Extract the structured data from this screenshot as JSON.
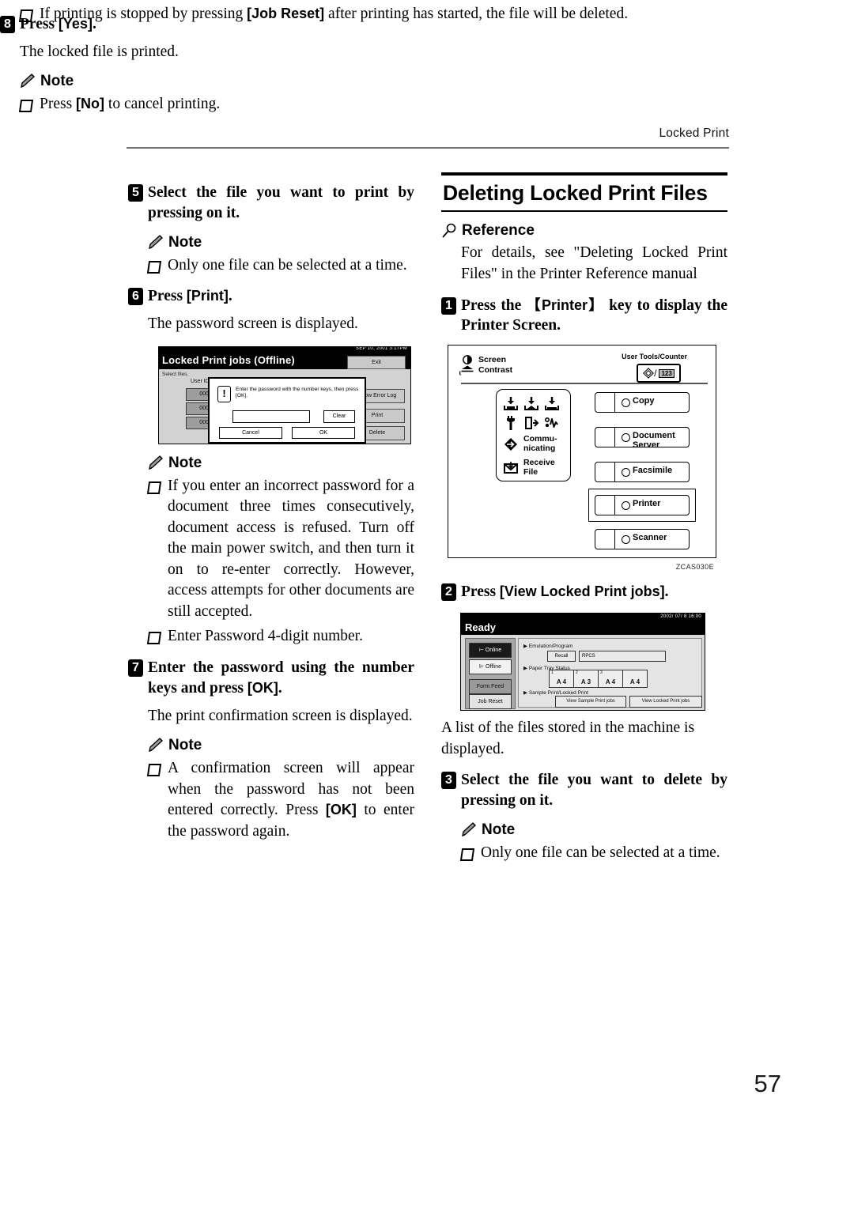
{
  "header": {
    "running_head": "Locked Print"
  },
  "page_number": "57",
  "left_column": {
    "step5": {
      "num": "5",
      "text": "Select the file you want to print by pressing on it."
    },
    "note1": {
      "label": "Note",
      "items": [
        "Only one file can be selected at a time."
      ]
    },
    "step6": {
      "num": "6",
      "text_before": "Press ",
      "key": "[Print]",
      "text_after": ".",
      "body": "The password screen is displayed."
    },
    "figure1": {
      "name": "locked-print-jobs-offline-screen",
      "date": "SEP  10, 2001  3:17PM",
      "title": "Locked Print jobs (Offline)",
      "exit_button": "Exit",
      "select_files_label": "Select files.",
      "user_id_label": "User ID",
      "file_items": [
        "0001",
        "0001",
        "0001"
      ],
      "right_buttons": [
        "Show Error Log",
        "Print",
        "Delete"
      ],
      "dialog": {
        "icon": "!",
        "message": "Enter the password with the number keys, then press [OK].",
        "input_value": "",
        "clear_button": "Clear",
        "cancel_button": "Cancel",
        "ok_button": "OK"
      }
    },
    "note2": {
      "label": "Note",
      "items": [
        "If you enter an incorrect password for a document three times consecutively, document access is refused. Turn off the main power switch, and then turn it on to re-enter correctly. However, access attempts for other documents are still accepted.",
        "Enter Password 4-digit number."
      ]
    },
    "step7": {
      "num": "7",
      "text_before": "Enter the password using the number keys and press ",
      "key": "[OK]",
      "text_after": ".",
      "body": "The print confirmation screen is displayed."
    },
    "note3": {
      "label": "Note",
      "item_part1": "A confirmation screen will appear when the password has not been entered correctly. Press ",
      "item_key": "[OK]",
      "item_part2": " to enter the password again."
    },
    "step8": {
      "num": "8",
      "text_before": "Press ",
      "key": "[Yes]",
      "text_after": ".",
      "body": "The locked file is printed."
    },
    "note4": {
      "label": "Note",
      "item1_part1": "Press ",
      "item1_key": "[No]",
      "item1_part2": " to cancel printing.",
      "item2_part1": "If printing is stopped by pressing ",
      "item2_key": "[Job Reset]",
      "item2_part2": " after printing has started, the file will be deleted."
    }
  },
  "right_column": {
    "section_title": "Deleting Locked Print Files",
    "reference": {
      "label": "Reference",
      "body": "For details, see \"Deleting Locked Print Files\" in the Printer Reference manual"
    },
    "step1": {
      "num": "1",
      "text_before": "Press the ",
      "key": "【Printer】",
      "text_after": " key to display the Printer Screen."
    },
    "figure2": {
      "name": "operation-panel-diagram",
      "screen_contrast_label": "Screen\nContrast",
      "screen_contrast_line1": "Screen",
      "screen_contrast_line2": "Contrast",
      "user_tools_label": "User Tools/Counter",
      "user_tools_123": "123",
      "status_icons": [
        {
          "icon": "load-paper-icon",
          "label": ""
        },
        {
          "icon": "add-toner-icon",
          "label": ""
        },
        {
          "icon": "clear-misfeed-icon",
          "label": ""
        },
        {
          "icon": "service-call-icon",
          "label": ""
        },
        {
          "icon": "open-cover-icon",
          "label": ""
        },
        {
          "icon": "add-staple-icon",
          "label": ""
        },
        {
          "icon": "communicating-icon",
          "label": "Commu-\nnicating"
        },
        {
          "icon": "receive-file-icon",
          "label": "Receive\nFile"
        }
      ],
      "communicating_l1": "Commu-",
      "communicating_l2": "nicating",
      "receive_l1": "Receive",
      "receive_l2": "File",
      "function_keys": [
        "Copy",
        "Document Server",
        "Facsimile",
        "Printer",
        "Scanner"
      ],
      "highlighted_key": "Printer",
      "caption": "ZCAS030E"
    },
    "step2": {
      "num": "2",
      "text_before": "Press ",
      "key": "[View Locked Print jobs]",
      "text_after": "."
    },
    "figure3": {
      "name": "printer-ready-screen",
      "date": "2002/ 07/ 8   16:00",
      "title": "Ready",
      "left_buttons": [
        "Online",
        "Offline",
        "Form Feed",
        "Job Reset"
      ],
      "section_emulation": "Emulation/Program",
      "recall_button": "Recall",
      "emulation_value": "RPCS",
      "section_paper_tray": "Paper Tray Status",
      "trays": [
        {
          "num": "1",
          "size": "A 4"
        },
        {
          "num": "2",
          "size": "A 3"
        },
        {
          "num": "3",
          "size": "A 4"
        },
        {
          "num": "",
          "size": "A 4"
        }
      ],
      "section_sample": "Sample Print/Locked Print",
      "view_sample_button": "View Sample Print jobs",
      "view_locked_button": "View Locked Print jobs"
    },
    "body_after_fig3": "A list of the files stored in the machine is displayed.",
    "step3": {
      "num": "3",
      "text": "Select the file you want to delete by pressing on it."
    },
    "note1": {
      "label": "Note",
      "items": [
        "Only one file can be selected at a time."
      ]
    }
  }
}
